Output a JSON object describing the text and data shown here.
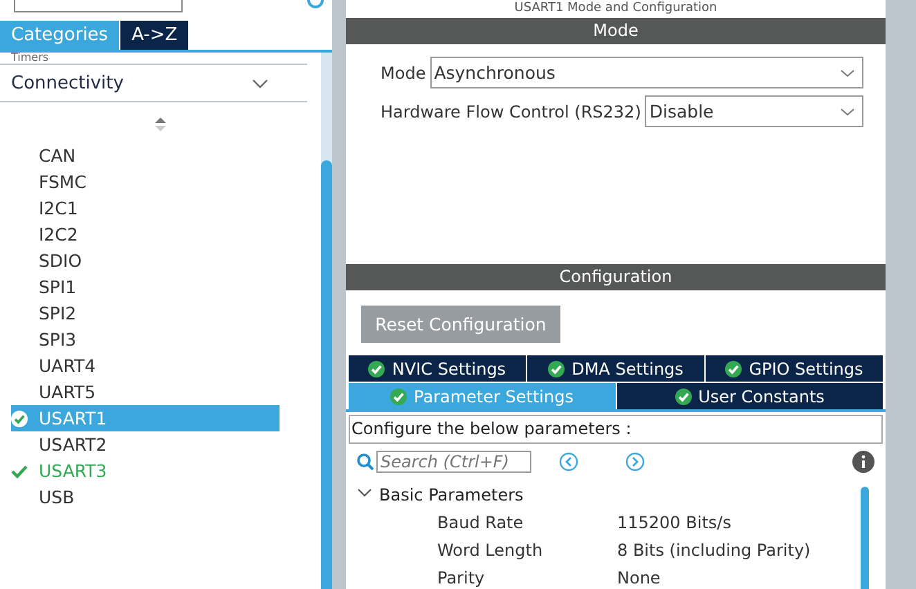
{
  "left": {
    "tabs": [
      {
        "label": "Categories",
        "selected": true
      },
      {
        "label": "A->Z",
        "selected": false
      }
    ],
    "categories": [
      {
        "label": "Timers",
        "expanded": false
      },
      {
        "label": "Connectivity",
        "expanded": true
      }
    ],
    "items": [
      {
        "label": "CAN",
        "selected": false,
        "configured": false
      },
      {
        "label": "FSMC",
        "selected": false,
        "configured": false
      },
      {
        "label": "I2C1",
        "selected": false,
        "configured": false
      },
      {
        "label": "I2C2",
        "selected": false,
        "configured": false
      },
      {
        "label": "SDIO",
        "selected": false,
        "configured": false
      },
      {
        "label": "SPI1",
        "selected": false,
        "configured": false
      },
      {
        "label": "SPI2",
        "selected": false,
        "configured": false
      },
      {
        "label": "SPI3",
        "selected": false,
        "configured": false
      },
      {
        "label": "UART4",
        "selected": false,
        "configured": false
      },
      {
        "label": "UART5",
        "selected": false,
        "configured": false
      },
      {
        "label": "USART1",
        "selected": true,
        "configured": true
      },
      {
        "label": "USART2",
        "selected": false,
        "configured": false
      },
      {
        "label": "USART3",
        "selected": false,
        "configured": true
      },
      {
        "label": "USB",
        "selected": false,
        "configured": false
      }
    ]
  },
  "right": {
    "title": "USART1 Mode and Configuration",
    "mode": {
      "header": "Mode",
      "fields": [
        {
          "label": "Mode",
          "value": "Asynchronous"
        },
        {
          "label": "Hardware Flow Control (RS232)",
          "value": "Disable"
        }
      ]
    },
    "configuration": {
      "header": "Configuration",
      "reset_button": {
        "label": "Reset Configuration",
        "disabled": true
      },
      "tab_rows": [
        [
          {
            "label": "NVIC Settings",
            "selected": false
          },
          {
            "label": "DMA Settings",
            "selected": false
          },
          {
            "label": "GPIO Settings",
            "selected": false
          }
        ],
        [
          {
            "label": "Parameter Settings",
            "selected": true
          },
          {
            "label": "User Constants",
            "selected": false
          }
        ]
      ],
      "hint": "Configure the below parameters :",
      "search": {
        "placeholder": "Search (Ctrl+F)"
      },
      "groups": [
        {
          "label": "Basic Parameters",
          "expanded": true,
          "children": [
            {
              "name": "Baud Rate",
              "value": "115200 Bits/s"
            },
            {
              "name": "Word Length",
              "value": "8 Bits (including Parity)"
            },
            {
              "name": "Parity",
              "value": "None"
            }
          ]
        }
      ]
    }
  }
}
